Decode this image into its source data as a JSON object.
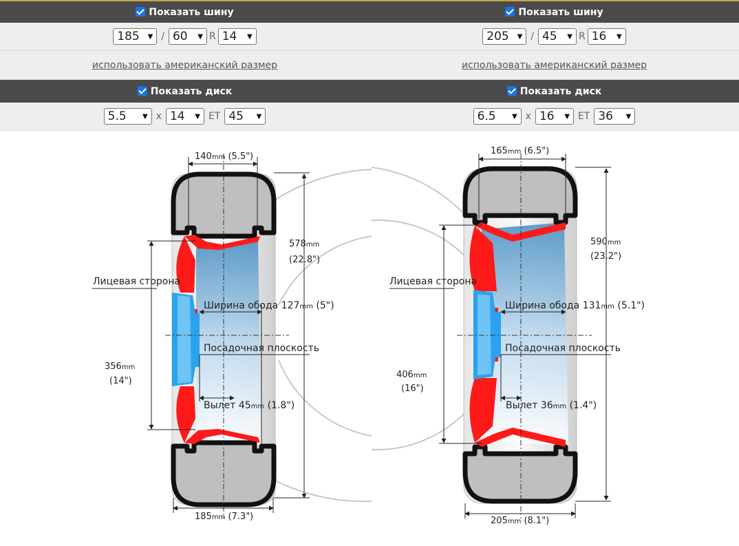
{
  "left": {
    "tire_header": "Показать шину",
    "tire": {
      "width": "185",
      "profile": "60",
      "r_label": "R",
      "diameter": "14",
      "slash": "/"
    },
    "american_link": "использовать американский размер",
    "disk_header": "Показать диск",
    "disk": {
      "width": "5.5",
      "x_label": "x",
      "diameter": "14",
      "et_label": "ET",
      "et": "45"
    }
  },
  "right": {
    "tire_header": "Показать шину",
    "tire": {
      "width": "205",
      "profile": "45",
      "r_label": "R",
      "diameter": "16",
      "slash": "/"
    },
    "american_link": "использовать американский размер",
    "disk_header": "Показать диск",
    "disk": {
      "width": "6.5",
      "x_label": "x",
      "diameter": "16",
      "et_label": "ET",
      "et": "36"
    }
  },
  "diagram": {
    "left": {
      "rim_width_top": "140",
      "rim_width_top_in": "(5.5\")",
      "outer_diameter": "578",
      "outer_diameter_in": "(22.8\")",
      "face_label": "Лицевая сторона",
      "rim_width_label": "Ширина обода",
      "rim_width": "127",
      "rim_width_in": "(5\")",
      "mount_label": "Посадочная плоскость",
      "rim_diameter": "356",
      "rim_diameter_in": "(14\")",
      "offset_label": "Вылет",
      "offset": "45",
      "offset_in": "(1.8\")",
      "tire_width": "185",
      "tire_width_in": "(7.3\")",
      "unit": "mm"
    },
    "right": {
      "rim_width_top": "165",
      "rim_width_top_in": "(6.5\")",
      "outer_diameter": "590",
      "outer_diameter_in": "(23.2\")",
      "face_label": "Лицевая сторона",
      "rim_width_label": "Ширина обода",
      "rim_width": "131",
      "rim_width_in": "(5.1\")",
      "mount_label": "Посадочная плоскость",
      "rim_diameter": "406",
      "rim_diameter_in": "(16\")",
      "offset_label": "Вылет",
      "offset": "36",
      "offset_in": "(1.4\")",
      "tire_width": "205",
      "tire_width_in": "(8.1\")",
      "unit": "mm"
    }
  }
}
